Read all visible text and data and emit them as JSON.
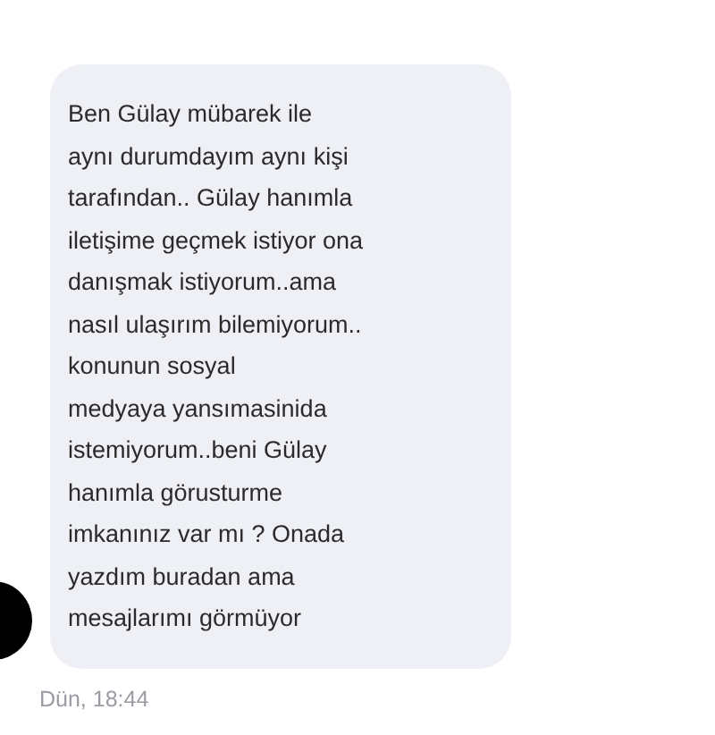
{
  "message": {
    "text": "Ben Gülay mübarek ile\naynı durumdayım aynı kişi\ntarafından.. Gülay hanımla\niletişime geçmek istiyor ona\ndanışmak istiyorum..ama\nnasıl ulaşırım bilemiyorum..\nkonunun sosyal\nmedyaya yansımasinida\nistemiyorum..beni Gülay\nhanımla görusturme\nimkanınız var mı ? Onada\nyazdım buradan ama\nmesajlarımı görmüyor",
    "time": "Dün, 18:44"
  }
}
